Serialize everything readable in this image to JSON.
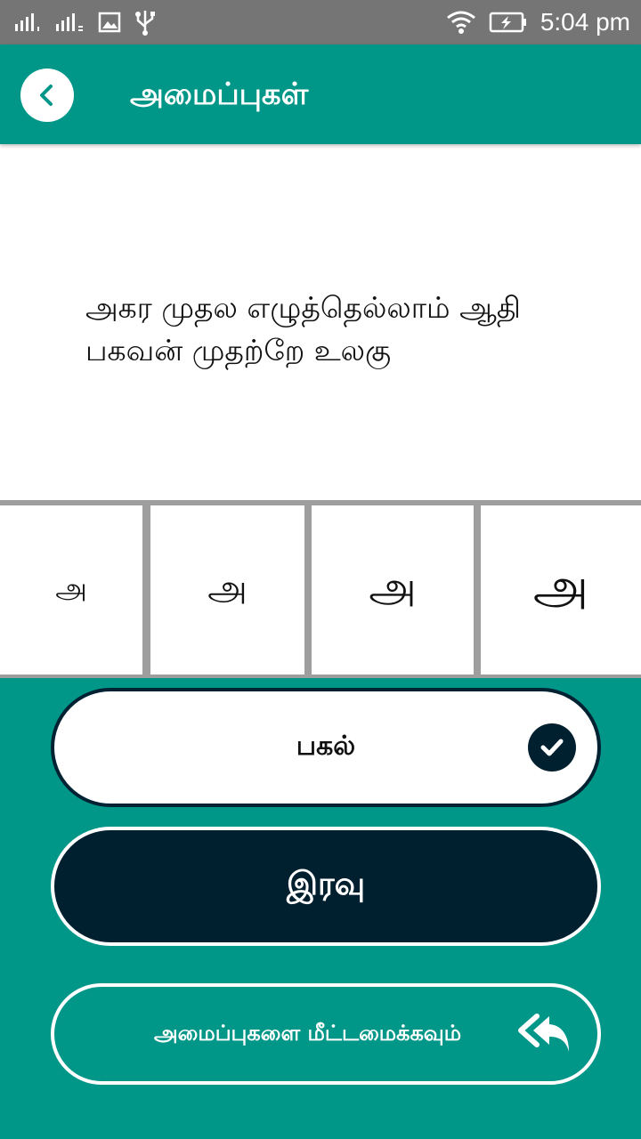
{
  "status_bar": {
    "time": "5:04 pm",
    "icons": [
      "signal-1-icon",
      "signal-2-icon",
      "image-icon",
      "usb-icon",
      "wifi-icon",
      "battery-charging-icon"
    ]
  },
  "app_bar": {
    "title": "அமைப்புகள்",
    "back_icon": "chevron-left-icon"
  },
  "preview": {
    "line1": "அகர முதல எழுத்தெல்லாம் ஆதி",
    "line2": "பகவன் முதற்றே உலகு"
  },
  "font_sizes": [
    {
      "label": "அ"
    },
    {
      "label": "அ"
    },
    {
      "label": "அ"
    },
    {
      "label": "அ"
    }
  ],
  "themes": {
    "day_label": "பகல்",
    "night_label": "இரவு",
    "selected": "day"
  },
  "reset": {
    "label": "அமைப்புகளை மீட்டமைக்கவும்",
    "icon": "reply-all-icon"
  },
  "colors": {
    "primary": "#009688",
    "dark": "#00202f",
    "status_bar": "#757575"
  }
}
